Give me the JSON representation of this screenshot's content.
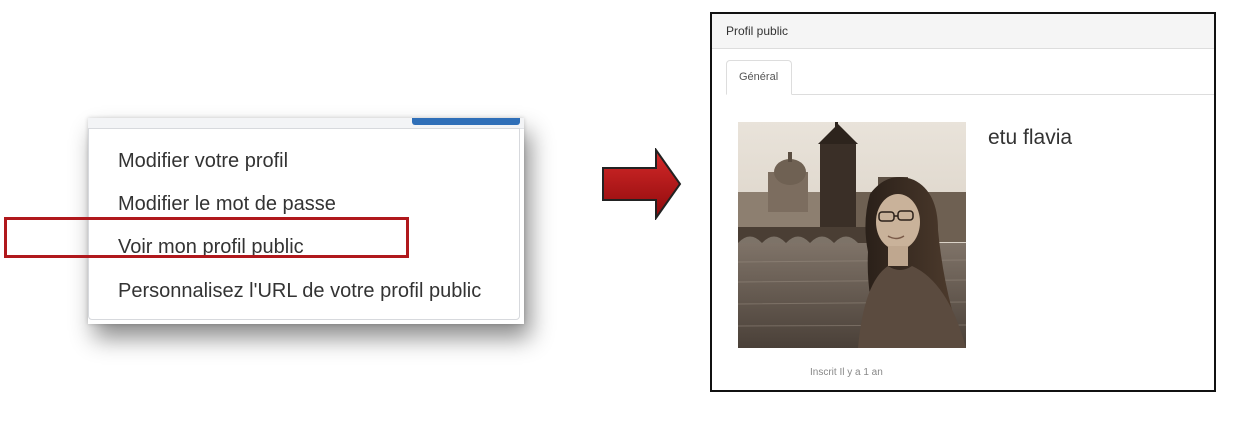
{
  "menu": {
    "items": [
      {
        "label": "Modifier votre profil"
      },
      {
        "label": "Modifier le mot de passe"
      },
      {
        "label": "Voir mon profil public",
        "highlighted": true
      },
      {
        "label": "Personnalisez l'URL de votre profil public"
      }
    ]
  },
  "colors": {
    "highlight": "#b0181c",
    "arrow_fill": "#b80f12",
    "accent_button": "#2f6fb8"
  },
  "profile": {
    "window_title": "Profil public",
    "tabs": [
      {
        "label": "Général",
        "active": true
      }
    ],
    "name": "etu flavia",
    "member_since": "Inscrit Il y a 1 an",
    "photo": "profile-photo-sepia"
  }
}
